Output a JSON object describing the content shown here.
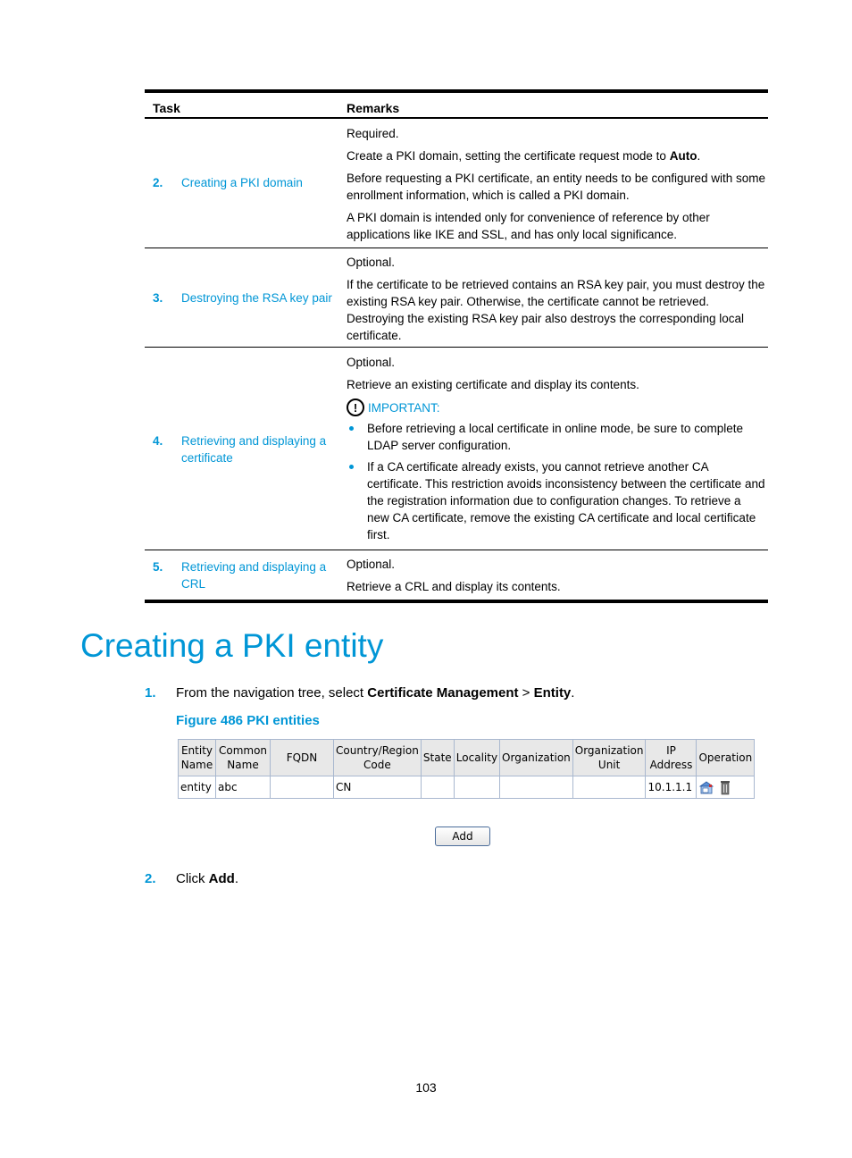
{
  "task_table": {
    "headers": {
      "task": "Task",
      "remarks": "Remarks"
    },
    "rows": [
      {
        "num": "2.",
        "task": "Creating a PKI domain",
        "remarks": [
          "Required.",
          "Create a PKI domain, setting the certificate request mode to ",
          "Before requesting a PKI certificate, an entity needs to be configured with some enrollment information, which is called a PKI domain.",
          "A PKI domain is intended only for convenience of reference by other applications like IKE and SSL, and has only local significance."
        ],
        "bold_term": "Auto",
        "bold_suffix": "."
      },
      {
        "num": "3.",
        "task": "Destroying the RSA key pair",
        "remarks": [
          "Optional.",
          "If the certificate to be retrieved contains an RSA key pair, you must destroy the existing RSA key pair. Otherwise, the certificate cannot be retrieved. Destroying the existing RSA key pair also destroys the corresponding local certificate."
        ]
      },
      {
        "num": "4.",
        "task": "Retrieving and displaying a certificate",
        "remarks": [
          "Optional.",
          "Retrieve an existing certificate and display its contents."
        ],
        "important_label": "IMPORTANT:",
        "bullets": [
          "Before retrieving a local certificate in online mode, be sure to complete LDAP server configuration.",
          "If a CA certificate already exists, you cannot retrieve another CA certificate. This restriction avoids inconsistency between the certificate and the registration information due to configuration changes. To retrieve a new CA certificate, remove the existing CA certificate and local certificate first."
        ]
      },
      {
        "num": "5.",
        "task": "Retrieving and displaying a CRL",
        "remarks": [
          "Optional.",
          "Retrieve a CRL and display its contents."
        ]
      }
    ]
  },
  "section_title": "Creating a PKI entity",
  "step1": {
    "num": "1.",
    "prefix": "From the navigation tree, select ",
    "bold1": "Certificate Management",
    "sep": " > ",
    "bold2": "Entity",
    "suffix": "."
  },
  "figure_caption": "Figure 486 PKI entities",
  "entity_table": {
    "headers": [
      "Entity Name",
      "Common Name",
      "FQDN",
      "Country/Region Code",
      "State",
      "Locality",
      "Organization",
      "Organization Unit",
      "IP Address",
      "Operation"
    ],
    "rows": [
      {
        "entity_name": "entity",
        "common_name": "abc",
        "fqdn": "",
        "country": "CN",
        "state": "",
        "locality": "",
        "organization": "",
        "org_unit": "",
        "ip": "10.1.1.1",
        "operations": [
          "edit-icon",
          "delete-icon"
        ]
      }
    ]
  },
  "add_button": "Add",
  "step2": {
    "num": "2.",
    "prefix": "Click ",
    "bold": "Add",
    "suffix": "."
  },
  "page_number": "103"
}
